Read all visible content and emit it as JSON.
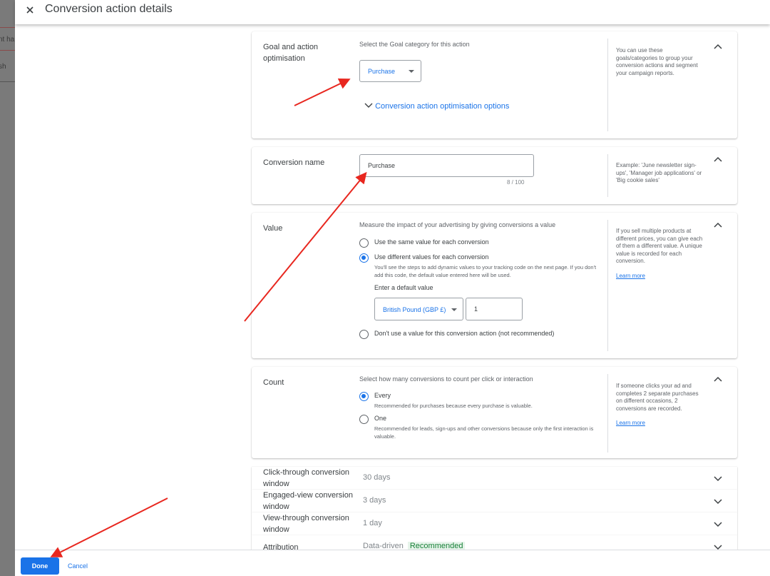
{
  "background_app": {
    "row_texts": [
      "",
      "nt ha",
      "sh"
    ]
  },
  "dialog": {
    "title": "Conversion action details",
    "close_icon": "close-icon"
  },
  "goal_section": {
    "title": "Goal and action optimisation",
    "subtitle": "Select the Goal category for this action",
    "category_select": {
      "value": "Purchase",
      "icon": "dropdown-arrow-icon"
    },
    "options_link": "Conversion action optimisation options",
    "options_link_icon": "chevron-down-icon",
    "help": "You can use these goals/categories to group your conversion actions and segment your campaign reports.",
    "collapse_icon": "chevron-up-icon"
  },
  "name_section": {
    "title": "Conversion name",
    "input_value": "Purchase",
    "counter": "8 / 100",
    "help": "Example: 'June newsletter sign-ups', 'Manager job applications' or 'Big cookie sales'"
  },
  "value_section": {
    "title": "Value",
    "subtitle": "Measure the impact of your advertising by giving conversions a value",
    "options": [
      {
        "label": "Use the same value for each conversion",
        "checked": false
      },
      {
        "label": "Use different values for each conversion",
        "checked": true,
        "description": "You'll see the steps to add dynamic values to your tracking code on the next page. If you don't add this code, the default value entered here will be used."
      },
      {
        "label": "Don't use a value for this conversion action (not recommended)",
        "checked": false
      }
    ],
    "default_value_label": "Enter a default value",
    "currency_select": "British Pound (GBP £)",
    "default_value": "1",
    "help": "If you sell multiple products at different prices, you can give each of them a different value. A unique value is recorded for each conversion.",
    "learn_more": "Learn more"
  },
  "count_section": {
    "title": "Count",
    "subtitle": "Select how many conversions to count per click or interaction",
    "options": [
      {
        "label": "Every",
        "checked": true,
        "description": "Recommended for purchases because every purchase is valuable."
      },
      {
        "label": "One",
        "checked": false,
        "description": "Recommended for leads, sign-ups and other conversions because only the first interaction is valuable."
      }
    ],
    "help": "If someone clicks your ad and completes 2 separate purchases on different occasions, 2 conversions are recorded.",
    "learn_more": "Learn more"
  },
  "settings_rows": [
    {
      "label": "Click-through conversion window",
      "value": "30 days"
    },
    {
      "label": "Engaged-view conversion window",
      "value": "3 days"
    },
    {
      "label": "View-through conversion window",
      "value": "1 day"
    },
    {
      "label": "Attribution",
      "value": "Data-driven",
      "badge": "Recommended"
    }
  ],
  "footer": {
    "done_label": "Done",
    "cancel_label": "Cancel"
  },
  "colors": {
    "accent": "#1a73e8",
    "annotation_arrow": "#e8271f",
    "recommended_badge_bg": "#e6f4ea",
    "recommended_badge_text": "#188038"
  }
}
